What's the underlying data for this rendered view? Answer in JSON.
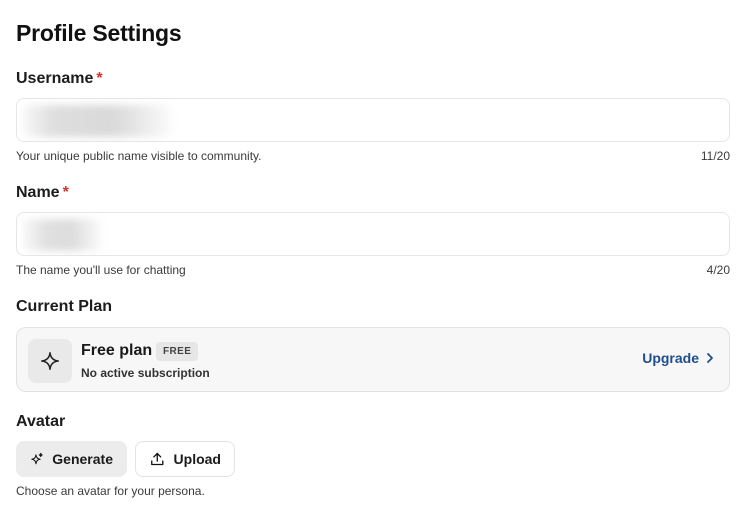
{
  "page": {
    "title": "Profile Settings"
  },
  "username": {
    "label": "Username",
    "required_mark": "*",
    "value": "",
    "helper": "Your unique public name visible to community.",
    "counter": "11/20"
  },
  "name": {
    "label": "Name",
    "required_mark": "*",
    "value": "",
    "helper": "The name you'll use for chatting",
    "counter": "4/20"
  },
  "plan": {
    "section_label": "Current Plan",
    "icon": "sparkle-icon",
    "name": "Free plan",
    "badge": "FREE",
    "subtitle": "No active subscription",
    "upgrade_label": "Upgrade",
    "upgrade_icon": "chevron-right-icon"
  },
  "avatar": {
    "section_label": "Avatar",
    "generate_label": "Generate",
    "generate_icon": "sparkles-icon",
    "upload_label": "Upload",
    "upload_icon": "upload-icon",
    "helper": "Choose an avatar for your persona."
  },
  "colors": {
    "required": "#d0342c",
    "link": "#1f4e8c",
    "card_bg": "#f7f7f7"
  }
}
